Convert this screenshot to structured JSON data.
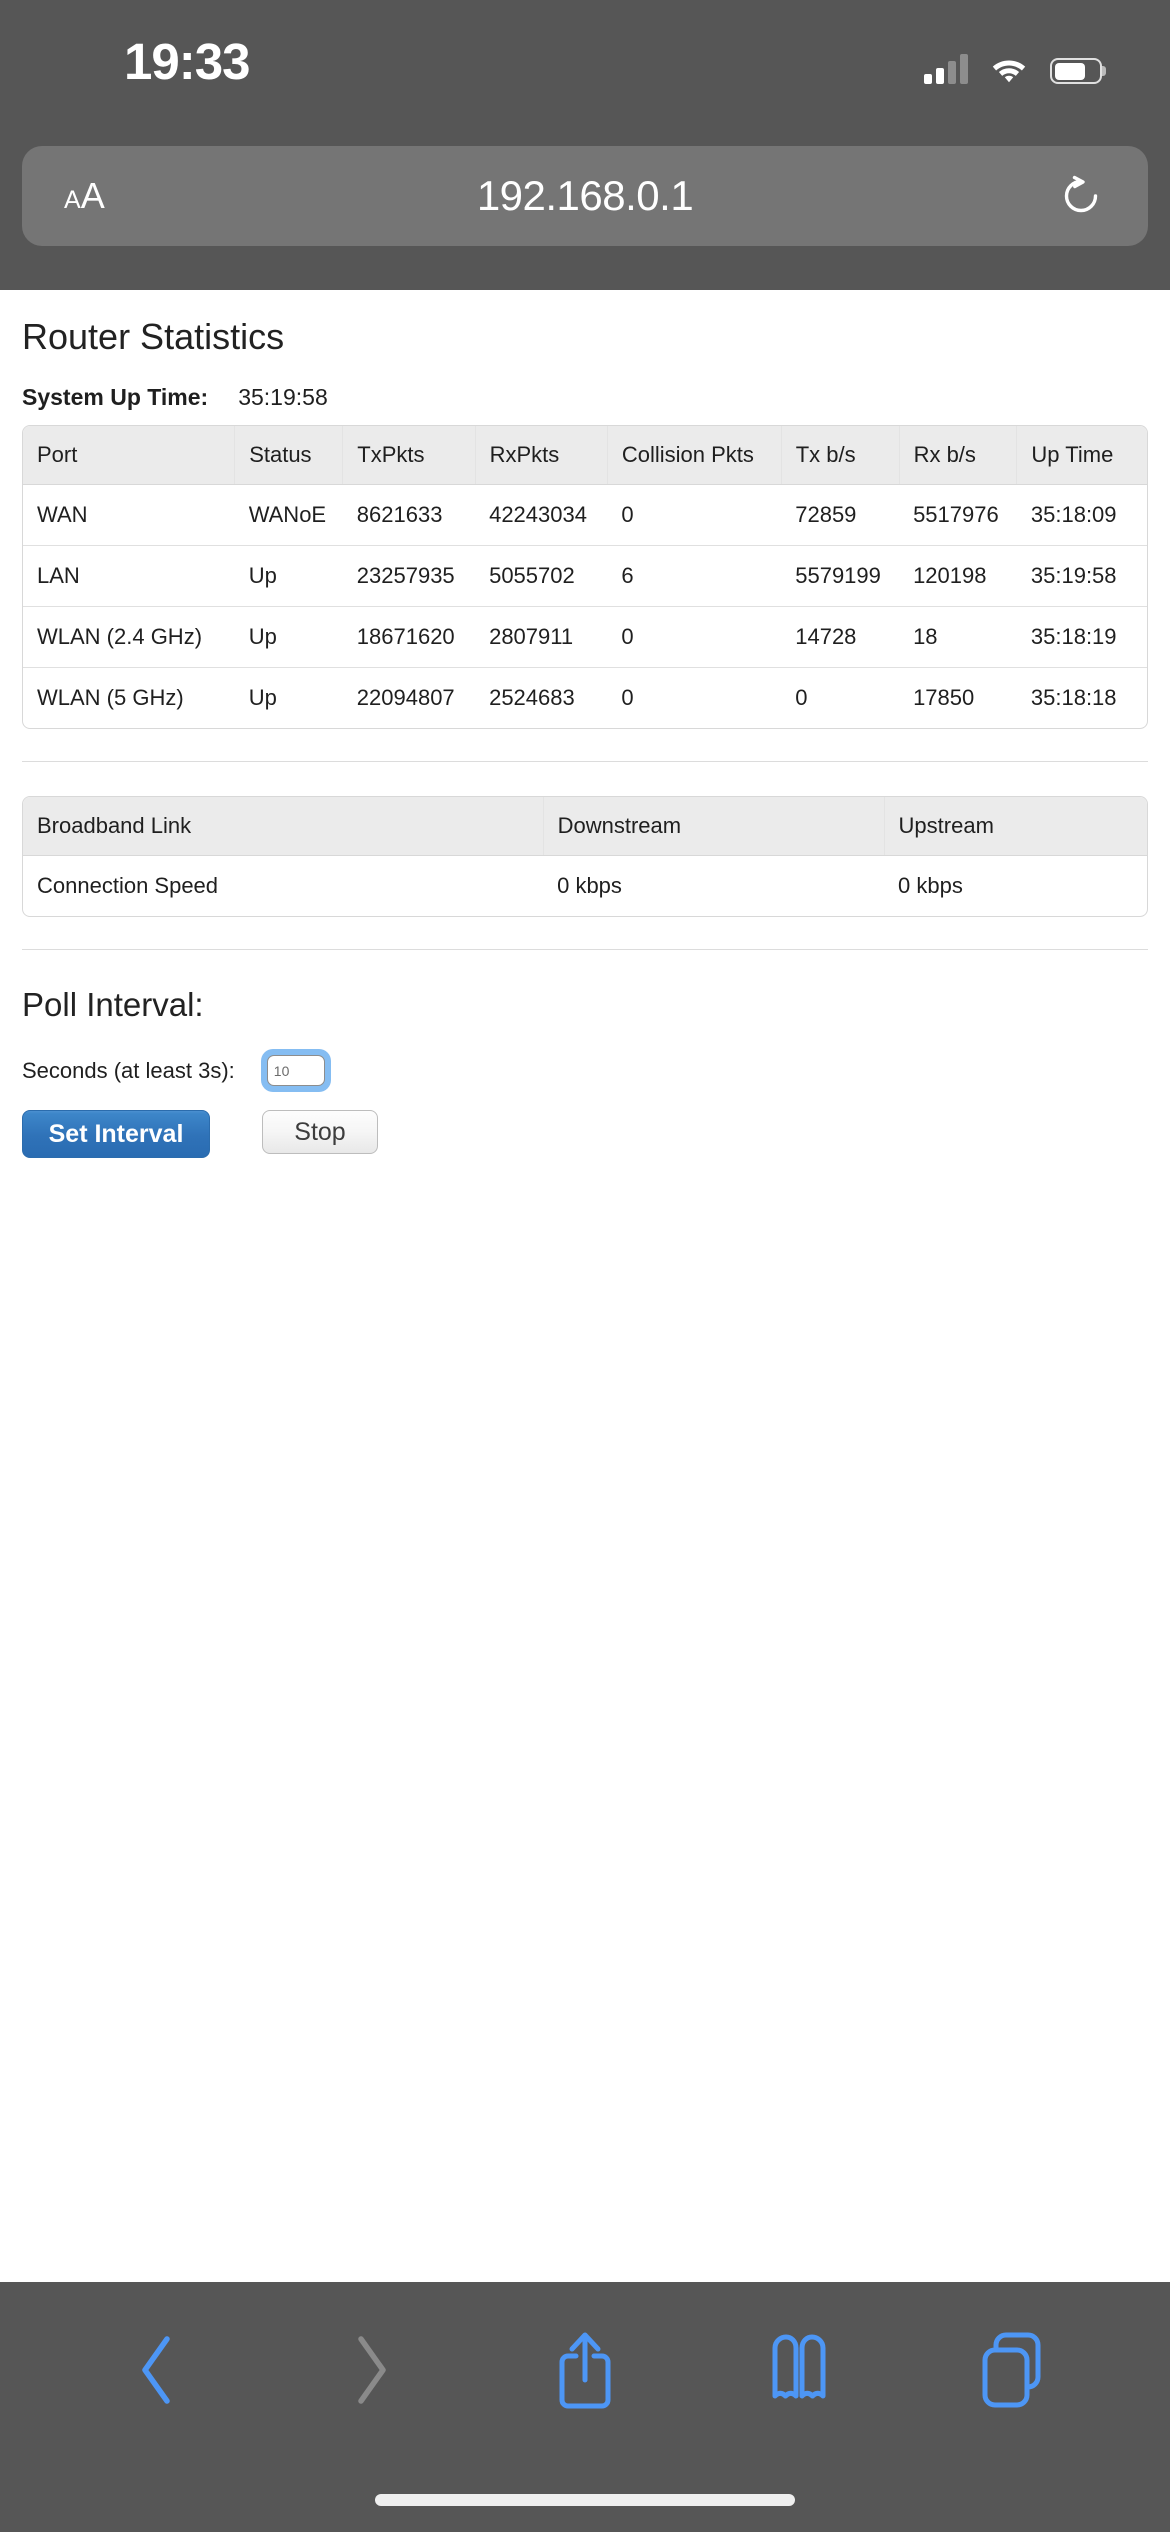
{
  "status_bar": {
    "time": "19:33",
    "signal_icon": "cellular-signal-icon",
    "wifi_icon": "wifi-icon",
    "battery_icon": "battery-icon"
  },
  "browser": {
    "text_size_label_small": "A",
    "text_size_label_large": "A",
    "url": "192.168.0.1",
    "reload_icon": "reload-icon"
  },
  "page": {
    "title": "Router Statistics",
    "uptime_label": "System Up Time:",
    "uptime_value": "35:19:58",
    "stats_table": {
      "headers": [
        "Port",
        "Status",
        "TxPkts",
        "RxPkts",
        "Collision Pkts",
        "Tx b/s",
        "Rx b/s",
        "Up Time"
      ],
      "rows": [
        [
          "WAN",
          "WANoE",
          "8621633",
          "42243034",
          "0",
          "72859",
          "5517976",
          "35:18:09"
        ],
        [
          "LAN",
          "Up",
          "23257935",
          "5055702",
          "6",
          "5579199",
          "120198",
          "35:19:58"
        ],
        [
          "WLAN (2.4 GHz)",
          "Up",
          "18671620",
          "2807911",
          "0",
          "14728",
          "18",
          "35:18:19"
        ],
        [
          "WLAN (5 GHz)",
          "Up",
          "22094807",
          "2524683",
          "0",
          "0",
          "17850",
          "35:18:18"
        ]
      ]
    },
    "broadband_table": {
      "headers": [
        "Broadband Link",
        "Downstream",
        "Upstream"
      ],
      "rows": [
        [
          "Connection Speed",
          "0 kbps",
          "0 kbps"
        ]
      ]
    },
    "poll": {
      "title": "Poll Interval:",
      "seconds_label": "Seconds (at least 3s):",
      "seconds_value": "10",
      "seconds_placeholder": "10",
      "set_interval_label": "Set Interval",
      "stop_label": "Stop"
    }
  },
  "toolbar": {
    "back_icon": "back-chevron-icon",
    "forward_icon": "forward-chevron-icon",
    "share_icon": "share-icon",
    "bookmarks_icon": "bookmarks-icon",
    "tabs_icon": "tabs-icon"
  },
  "colors": {
    "chrome": "#565656",
    "url_pill": "#757575",
    "accent_blue": "#3a86d4",
    "toolbar_blue": "#4d96f5",
    "table_header": "#ebebeb",
    "focus_ring": "#85bdf2"
  }
}
